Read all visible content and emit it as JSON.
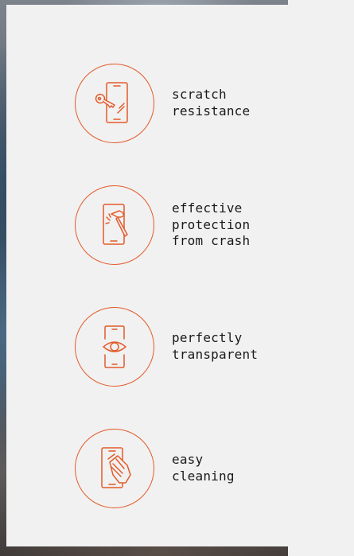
{
  "features": [
    {
      "label": "scratch\nresistance",
      "icon": "phone-key-scratch-icon"
    },
    {
      "label": "effective\nprotection\nfrom crash",
      "icon": "phone-hammer-icon"
    },
    {
      "label": "perfectly\ntransparent",
      "icon": "phone-eye-icon"
    },
    {
      "label": "easy\ncleaning",
      "icon": "phone-hand-cleaning-icon"
    }
  ],
  "colors": {
    "accent": "#e35b2b",
    "panel": "#f1f1f1",
    "text": "#1a1a1a"
  }
}
